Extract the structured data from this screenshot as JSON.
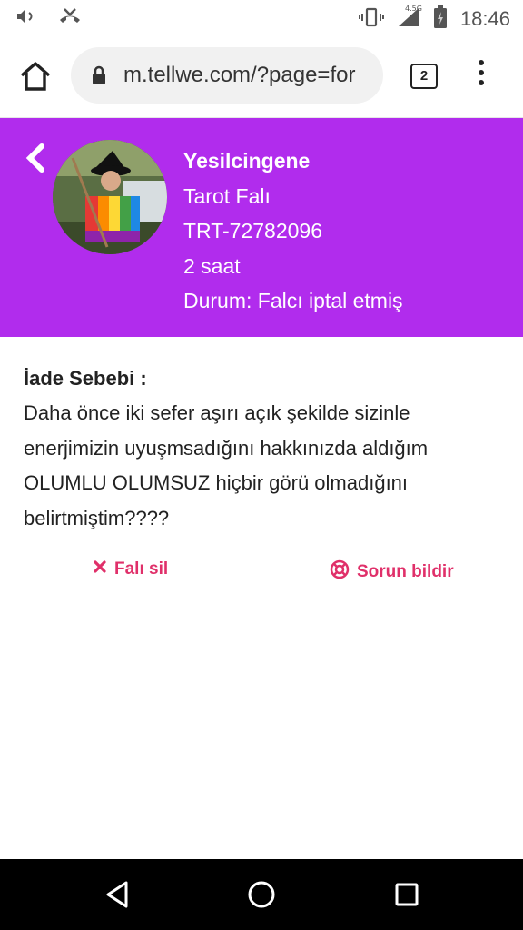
{
  "status_bar": {
    "time": "18:46",
    "network": "4.5G",
    "icons": [
      "volume-icon",
      "missed-call-icon",
      "vibrate-icon",
      "signal-icon",
      "battery-charging-icon"
    ]
  },
  "browser": {
    "url": "m.tellwe.com/?page=for",
    "tab_count": "2"
  },
  "header": {
    "name": "Yesilcingene",
    "category": "Tarot Falı",
    "code": "TRT-72782096",
    "time_ago": "2 saat",
    "status": "Durum: Falcı iptal etmiş",
    "bg_color": "#b12ced"
  },
  "refund": {
    "title": "İade Sebebi :",
    "text": "Daha önce iki sefer aşırı açık şekilde sizinle enerjimizin uyuşmsadığını hakkınızda aldığım OLUMLU OLUMSUZ hiçbir görü olmadığını belirtmiştim????"
  },
  "actions": {
    "delete_label": "Falı sil",
    "report_label": "Sorun bildir",
    "accent_color": "#e0306a"
  }
}
